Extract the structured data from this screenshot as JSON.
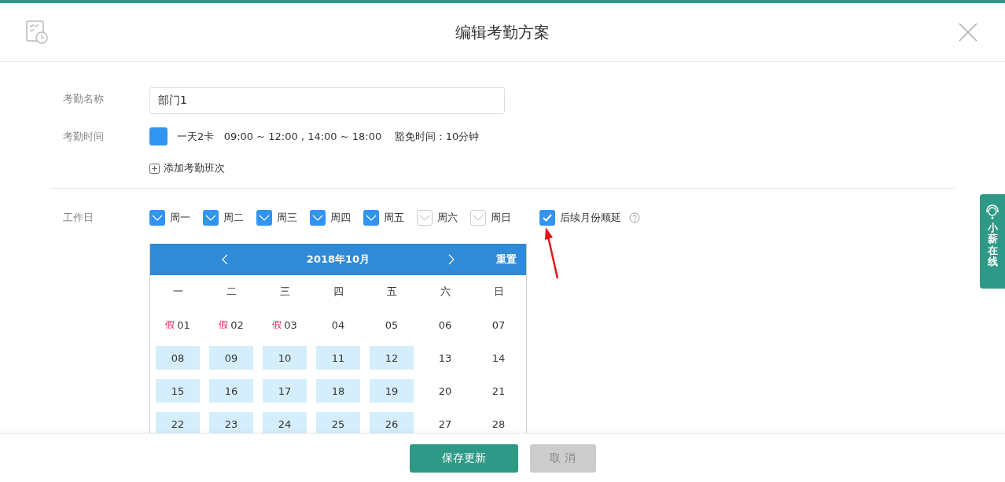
{
  "header": {
    "title": "编辑考勤方案"
  },
  "form": {
    "name_label": "考勤名称",
    "name_value": "部门1",
    "time_label": "考勤时间",
    "shift": {
      "color": "#3194f0",
      "text": "一天2卡   09:00 ~ 12:00 , 14:00 ~ 18:00    豁免时间：10分钟"
    },
    "add_shift": "添加考勤班次",
    "workday_label": "工作日"
  },
  "weekdays": [
    {
      "label": "周一",
      "checked": true
    },
    {
      "label": "周二",
      "checked": true
    },
    {
      "label": "周三",
      "checked": true
    },
    {
      "label": "周四",
      "checked": true
    },
    {
      "label": "周五",
      "checked": true
    },
    {
      "label": "周六",
      "checked": false
    },
    {
      "label": "周日",
      "checked": false
    }
  ],
  "carry_over": {
    "label": "后续月份顺延",
    "checked": true
  },
  "calendar": {
    "title": "2018年10月",
    "reset": "重置",
    "weekday_heads": [
      "一",
      "二",
      "三",
      "四",
      "五",
      "六",
      "日"
    ],
    "days": [
      {
        "day": "01",
        "tag": "假",
        "workday": false
      },
      {
        "day": "02",
        "tag": "假",
        "workday": false
      },
      {
        "day": "03",
        "tag": "假",
        "workday": false
      },
      {
        "day": "04",
        "workday": false
      },
      {
        "day": "05",
        "workday": false
      },
      {
        "day": "06",
        "workday": false
      },
      {
        "day": "07",
        "workday": false
      },
      {
        "day": "08",
        "workday": true
      },
      {
        "day": "09",
        "workday": true
      },
      {
        "day": "10",
        "workday": true
      },
      {
        "day": "11",
        "workday": true
      },
      {
        "day": "12",
        "workday": true
      },
      {
        "day": "13",
        "workday": false
      },
      {
        "day": "14",
        "workday": false
      },
      {
        "day": "15",
        "workday": true
      },
      {
        "day": "16",
        "workday": true
      },
      {
        "day": "17",
        "workday": true
      },
      {
        "day": "18",
        "workday": true
      },
      {
        "day": "19",
        "workday": true
      },
      {
        "day": "20",
        "workday": false
      },
      {
        "day": "21",
        "workday": false
      },
      {
        "day": "22",
        "workday": true
      },
      {
        "day": "23",
        "workday": true
      },
      {
        "day": "24",
        "workday": true
      },
      {
        "day": "25",
        "workday": true
      },
      {
        "day": "26",
        "workday": true
      },
      {
        "day": "27",
        "workday": false
      },
      {
        "day": "28",
        "workday": false
      }
    ]
  },
  "footer": {
    "save": "保存更新",
    "cancel": "取 消"
  },
  "side_tab": {
    "label": "小薪在线"
  }
}
